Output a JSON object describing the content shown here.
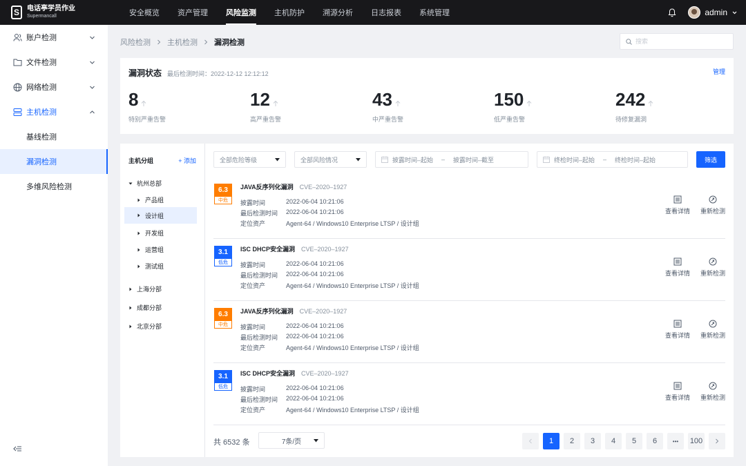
{
  "app": {
    "title": "电话亭学员作业",
    "subtitle": "Supermancall",
    "logo_letter": "S"
  },
  "topnav": [
    "安全概览",
    "资产管理",
    "风险监测",
    "主机防护",
    "溯源分析",
    "日志报表",
    "系统管理"
  ],
  "topnav_active": "风险监测",
  "user": {
    "name": "admin"
  },
  "sidebar": {
    "items": [
      {
        "label": "账户检测",
        "icon": "user-icon"
      },
      {
        "label": "文件检测",
        "icon": "folder-icon"
      },
      {
        "label": "网络检测",
        "icon": "globe-icon"
      },
      {
        "label": "主机检测",
        "icon": "server-icon"
      }
    ],
    "sub_items": [
      "基线检测",
      "漏洞检测",
      "多维风险检测"
    ],
    "active_sub": "漏洞检测"
  },
  "breadcrumb": [
    "风险检测",
    "主机检测",
    "漏洞检测"
  ],
  "search": {
    "placeholder": "搜索",
    "value": ""
  },
  "status": {
    "title": "漏洞状态",
    "last_check": "最后检测时间：2022-12-12 12:12:12",
    "manage": "管理",
    "stats": [
      {
        "value": "8",
        "label": "特别严重告警"
      },
      {
        "value": "12",
        "label": "高严重告警"
      },
      {
        "value": "43",
        "label": "中严重告警"
      },
      {
        "value": "150",
        "label": "低严重告警"
      },
      {
        "value": "242",
        "label": "待修复漏洞"
      }
    ]
  },
  "tree": {
    "title": "主机分组",
    "add": "+ 添加",
    "nodes": [
      "杭州总部",
      "产品组",
      "设计组",
      "开发组",
      "运营组",
      "测试组",
      "上海分部",
      "成都分部",
      "北京分部"
    ],
    "selected": "设计组"
  },
  "filters": {
    "risk_level": "全部危险等级",
    "risk_status": "全部风险情况",
    "disclose_start": "披露时间–起始",
    "disclose_end": "披露时间–截至",
    "check_start": "终检时间–起始",
    "check_end": "终检时间–起始",
    "range_sep": "–",
    "button": "筛选"
  },
  "vulns": [
    {
      "score": "6.3",
      "level": "中危",
      "severity": "mid",
      "name": "JAVA反序列化漏洞",
      "cve": "CVE–2020–1927",
      "disclose_label": "披露时间",
      "disclose": "2022-06-04 10:21:06",
      "check_label": "最后检测时间",
      "check": "2022-06-04 10:21:06",
      "asset_label": "定位资产",
      "asset": "Agent-64 / Windows10 Enterprise LTSP / 设计组"
    },
    {
      "score": "3.1",
      "level": "低危",
      "severity": "low",
      "name": "ISC DHCP安全漏洞",
      "cve": "CVE–2020–1927",
      "disclose_label": "披露时间",
      "disclose": "2022-06-04 10:21:06",
      "check_label": "最后检测时间",
      "check": "2022-06-04 10:21:06",
      "asset_label": "定位资产",
      "asset": "Agent-64 / Windows10 Enterprise LTSP / 设计组"
    },
    {
      "score": "6.3",
      "level": "中危",
      "severity": "mid",
      "name": "JAVA反序列化漏洞",
      "cve": "CVE–2020–1927",
      "disclose_label": "披露时间",
      "disclose": "2022-06-04 10:21:06",
      "check_label": "最后检测时间",
      "check": "2022-06-04 10:21:06",
      "asset_label": "定位资产",
      "asset": "Agent-64 / Windows10 Enterprise LTSP / 设计组"
    },
    {
      "score": "3.1",
      "level": "低危",
      "severity": "low",
      "name": "ISC DHCP安全漏洞",
      "cve": "CVE–2020–1927",
      "disclose_label": "披露时间",
      "disclose": "2022-06-04 10:21:06",
      "check_label": "最后检测时间",
      "check": "2022-06-04 10:21:06",
      "asset_label": "定位资产",
      "asset": "Agent-64 / Windows10 Enterprise LTSP / 设计组"
    }
  ],
  "actions": {
    "detail": "查看详情",
    "recheck": "重新检测"
  },
  "pagination": {
    "total": "共 6532 条",
    "page_size": "7条/页",
    "pages": [
      "1",
      "2",
      "3",
      "4",
      "5",
      "6",
      "•••",
      "100"
    ],
    "current": "1"
  },
  "colors": {
    "primary": "#1664ff",
    "mid": "#ff7d00",
    "topbar": "#18181b"
  }
}
